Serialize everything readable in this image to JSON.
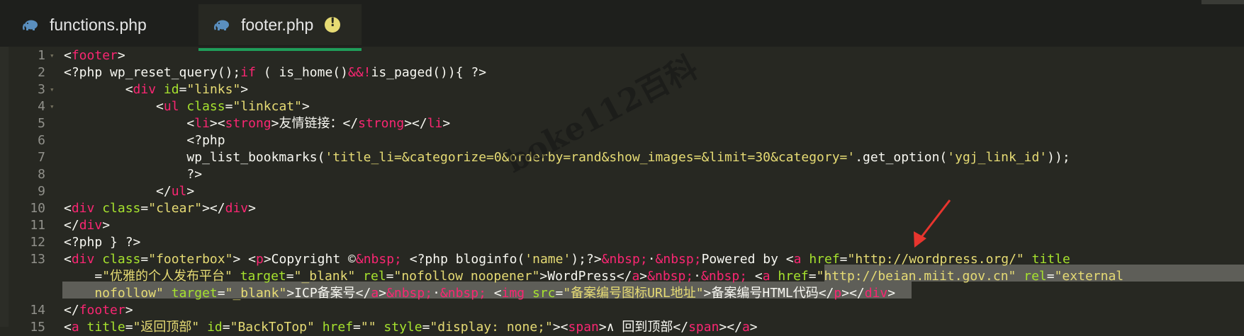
{
  "tabs": [
    {
      "label": "functions.php",
      "icon": "php-elephant-icon",
      "active": false
    },
    {
      "label": "footer.php",
      "icon": "php-elephant-icon",
      "active": true,
      "badge_icon": "warning-icon",
      "badge_text": "!"
    }
  ],
  "colors": {
    "tag": "#f92672",
    "attribute": "#a6e22e",
    "string": "#e6db74",
    "text": "#f8f8f2",
    "active_tab_underline": "#1f9e5a",
    "selection": "#5e5e58",
    "annotation_arrow": "#e8352e"
  },
  "line_numbers": [
    "1",
    "2",
    "3",
    "4",
    "5",
    "6",
    "7",
    "8",
    "9",
    "10",
    "11",
    "12",
    "13",
    "14",
    "15"
  ],
  "code_lines": [
    {
      "n": "1",
      "fold": true,
      "segments": [
        [
          "c",
          "<"
        ],
        [
          "t",
          "footer"
        ],
        [
          "c",
          ">"
        ]
      ]
    },
    {
      "n": "2",
      "fold": false,
      "segments": [
        [
          "c",
          "<?php wp_reset_query();"
        ],
        [
          "t",
          "if"
        ],
        [
          "c",
          " ( is_home()"
        ],
        [
          "t",
          "&&!"
        ],
        [
          "c",
          "is_paged()){ ?>"
        ]
      ]
    },
    {
      "n": "3",
      "fold": true,
      "segments": [
        [
          "c",
          "        <"
        ],
        [
          "t",
          "div"
        ],
        [
          "c",
          " "
        ],
        [
          "a",
          "id"
        ],
        [
          "c",
          "="
        ],
        [
          "s",
          "\"links\""
        ],
        [
          "c",
          ">"
        ]
      ]
    },
    {
      "n": "4",
      "fold": true,
      "segments": [
        [
          "c",
          "            <"
        ],
        [
          "t",
          "ul"
        ],
        [
          "c",
          " "
        ],
        [
          "a",
          "class"
        ],
        [
          "c",
          "="
        ],
        [
          "s",
          "\"linkcat\""
        ],
        [
          "c",
          ">"
        ]
      ]
    },
    {
      "n": "5",
      "fold": false,
      "segments": [
        [
          "c",
          "                <"
        ],
        [
          "t",
          "li"
        ],
        [
          "c",
          "><"
        ],
        [
          "t",
          "strong"
        ],
        [
          "c",
          ">友情链接：</"
        ],
        [
          "t",
          "strong"
        ],
        [
          "c",
          "></"
        ],
        [
          "t",
          "li"
        ],
        [
          "c",
          ">"
        ]
      ]
    },
    {
      "n": "6",
      "fold": false,
      "segments": [
        [
          "c",
          "                <?php"
        ]
      ]
    },
    {
      "n": "7",
      "fold": false,
      "segments": [
        [
          "c",
          "                wp_list_bookmarks("
        ],
        [
          "s",
          "'title_li=&categorize=0&orderby=rand&show_images=&limit=30&category='"
        ],
        [
          "c",
          ".get_option("
        ],
        [
          "s",
          "'ygj_link_id'"
        ],
        [
          "c",
          "));"
        ]
      ]
    },
    {
      "n": "8",
      "fold": false,
      "segments": [
        [
          "c",
          "                ?>"
        ]
      ]
    },
    {
      "n": "9",
      "fold": false,
      "segments": [
        [
          "c",
          "            </"
        ],
        [
          "t",
          "ul"
        ],
        [
          "c",
          ">"
        ]
      ]
    },
    {
      "n": "10",
      "fold": false,
      "segments": [
        [
          "c",
          "<"
        ],
        [
          "t",
          "div"
        ],
        [
          "c",
          " "
        ],
        [
          "a",
          "class"
        ],
        [
          "c",
          "="
        ],
        [
          "s",
          "\"clear\""
        ],
        [
          "c",
          "></"
        ],
        [
          "t",
          "div"
        ],
        [
          "c",
          ">"
        ]
      ]
    },
    {
      "n": "11",
      "fold": false,
      "segments": [
        [
          "c",
          "</"
        ],
        [
          "t",
          "div"
        ],
        [
          "c",
          ">"
        ]
      ]
    },
    {
      "n": "12",
      "fold": false,
      "segments": [
        [
          "c",
          "<?php } ?>"
        ]
      ]
    },
    {
      "n": "13",
      "fold": false,
      "segments": [
        [
          "c",
          "<"
        ],
        [
          "t",
          "div"
        ],
        [
          "c",
          " "
        ],
        [
          "a",
          "class"
        ],
        [
          "c",
          "="
        ],
        [
          "s",
          "\"footerbox\""
        ],
        [
          "c",
          "> <"
        ],
        [
          "t",
          "p"
        ],
        [
          "c",
          ">Copyright ©"
        ],
        [
          "t",
          "&nbsp;"
        ],
        [
          "c",
          " <?php bloginfo("
        ],
        [
          "s",
          "'name'"
        ],
        [
          "c",
          ");?>"
        ],
        [
          "t",
          "&nbsp;"
        ],
        [
          "c",
          "·"
        ],
        [
          "t",
          "&nbsp;"
        ],
        [
          "c",
          "Powered by <"
        ],
        [
          "t",
          "a"
        ],
        [
          "c",
          " "
        ],
        [
          "a",
          "href"
        ],
        [
          "c",
          "="
        ],
        [
          "s",
          "\"http://wordpress.org/\""
        ],
        [
          "c",
          " "
        ],
        [
          "a",
          "title"
        ]
      ]
    },
    {
      "n": "",
      "fold": false,
      "segments": [
        [
          "c",
          "    ="
        ],
        [
          "s",
          "\"优雅的个人发布平台\""
        ],
        [
          "c",
          " "
        ],
        [
          "a",
          "target"
        ],
        [
          "c",
          "="
        ],
        [
          "s",
          "\"_blank\""
        ],
        [
          "c",
          " "
        ],
        [
          "a",
          "rel"
        ],
        [
          "c",
          "="
        ],
        [
          "s",
          "\"nofollow noopener\""
        ],
        [
          "c",
          ">WordPress</"
        ],
        [
          "t",
          "a"
        ],
        [
          "c",
          ">"
        ],
        [
          "t",
          "&nbsp;"
        ],
        [
          "c",
          "·"
        ],
        [
          "t",
          "&nbsp;"
        ],
        [
          "c",
          " <"
        ],
        [
          "t",
          "a"
        ],
        [
          "c",
          " "
        ],
        [
          "a",
          "href"
        ],
        [
          "c",
          "="
        ],
        [
          "s",
          "\"http://beian.miit.gov.cn\""
        ],
        [
          "c",
          " "
        ],
        [
          "a",
          "rel"
        ],
        [
          "c",
          "="
        ],
        [
          "s",
          "\"external"
        ]
      ]
    },
    {
      "n": "",
      "fold": false,
      "segments": [
        [
          "s",
          "    nofollow\""
        ],
        [
          "c",
          " "
        ],
        [
          "a",
          "target"
        ],
        [
          "c",
          "="
        ],
        [
          "s",
          "\"_blank\""
        ],
        [
          "c",
          ">ICP备案号</"
        ],
        [
          "t",
          "a"
        ],
        [
          "c",
          ">"
        ],
        [
          "t",
          "&nbsp;"
        ],
        [
          "c",
          "·"
        ],
        [
          "t",
          "&nbsp;"
        ],
        [
          "c",
          " <"
        ],
        [
          "t",
          "img"
        ],
        [
          "c",
          " "
        ],
        [
          "a",
          "src"
        ],
        [
          "c",
          "="
        ],
        [
          "s",
          "\"备案编号图标URL地址\""
        ],
        [
          "c",
          ">备案编号HTML代码</"
        ],
        [
          "t",
          "p"
        ],
        [
          "c",
          "></"
        ],
        [
          "t",
          "div"
        ],
        [
          "c",
          ">"
        ]
      ]
    },
    {
      "n": "14",
      "fold": false,
      "segments": [
        [
          "c",
          "</"
        ],
        [
          "t",
          "footer"
        ],
        [
          "c",
          ">"
        ]
      ]
    },
    {
      "n": "15",
      "fold": false,
      "segments": [
        [
          "c",
          "<"
        ],
        [
          "t",
          "a"
        ],
        [
          "c",
          " "
        ],
        [
          "a",
          "title"
        ],
        [
          "c",
          "="
        ],
        [
          "s",
          "\"返回顶部\""
        ],
        [
          "c",
          " "
        ],
        [
          "a",
          "id"
        ],
        [
          "c",
          "="
        ],
        [
          "s",
          "\"BackToTop\""
        ],
        [
          "c",
          " "
        ],
        [
          "a",
          "href"
        ],
        [
          "c",
          "="
        ],
        [
          "s",
          "\"\""
        ],
        [
          "c",
          " "
        ],
        [
          "a",
          "style"
        ],
        [
          "c",
          "="
        ],
        [
          "s",
          "\"display: none;\""
        ],
        [
          "c",
          "><"
        ],
        [
          "t",
          "span"
        ],
        [
          "c",
          ">∧ 回到顶部</"
        ],
        [
          "t",
          "span"
        ],
        [
          "c",
          "></"
        ],
        [
          "t",
          "a"
        ],
        [
          "c",
          ">"
        ]
      ]
    }
  ],
  "watermark": "boke112百科"
}
